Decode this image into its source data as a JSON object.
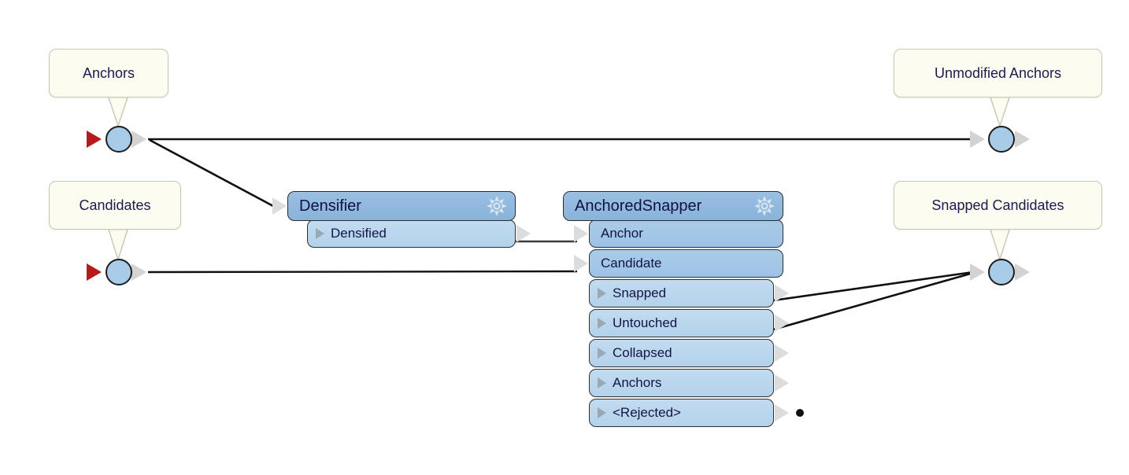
{
  "diagram": {
    "title": "AnchoredSnapper data flow graph",
    "background": "#ffffff",
    "colors": {
      "balloon_fill": "#fdfcf0",
      "balloon_border": "#c9c6b4",
      "header_fill": "#8ab3da",
      "input_row_fill": "#9dc3e4",
      "output_row_fill": "#b3d2ea",
      "port_circle_fill": "#a8cbe8",
      "required_marker": "#b51b1b",
      "connector_arrow": "#dcdcdc",
      "wire": "#111111",
      "text": "#141446"
    }
  },
  "labels": {
    "anchors": "Anchors",
    "candidates": "Candidates",
    "unmodified_anchors": "Unmodified Anchors",
    "snapped_candidates": "Snapped Candidates"
  },
  "modules": [
    {
      "id": "densifier",
      "title": "Densifier",
      "settings_icon": "gear-icon",
      "rows": [
        {
          "label": "Densified",
          "kind": "output",
          "expander": true,
          "arrow": "out"
        }
      ]
    },
    {
      "id": "anchored_snapper",
      "title": "AnchoredSnapper",
      "settings_icon": "gear-icon",
      "rows": [
        {
          "label": "Anchor",
          "kind": "input",
          "expander": false,
          "arrow": "in"
        },
        {
          "label": "Candidate",
          "kind": "input",
          "expander": false,
          "arrow": "in"
        },
        {
          "label": "Snapped",
          "kind": "output",
          "expander": true,
          "arrow": "out"
        },
        {
          "label": "Untouched",
          "kind": "output",
          "expander": true,
          "arrow": "out"
        },
        {
          "label": "Collapsed",
          "kind": "output",
          "expander": true,
          "arrow": "out"
        },
        {
          "label": "Anchors",
          "kind": "output",
          "expander": true,
          "arrow": "out"
        },
        {
          "label": "<Rejected>",
          "kind": "output",
          "expander": true,
          "arrow": "out",
          "terminator_dot": true
        }
      ]
    }
  ],
  "graph_ports": [
    {
      "id": "anchors-port",
      "role": "source",
      "required_marker": true,
      "label_ref": "anchors"
    },
    {
      "id": "candidates-port",
      "role": "source",
      "required_marker": true,
      "label_ref": "candidates"
    },
    {
      "id": "unmodified-anchors-port",
      "role": "sink",
      "required_marker": false,
      "label_ref": "unmodified_anchors"
    },
    {
      "id": "snapped-candidates-port",
      "role": "sink",
      "required_marker": false,
      "label_ref": "snapped_candidates"
    }
  ],
  "connections": [
    {
      "from": "anchors-port",
      "to": "unmodified-anchors-port"
    },
    {
      "from": "anchors-port",
      "to": "densifier.input"
    },
    {
      "from": "densifier.Densified",
      "to": "anchored_snapper.Anchor"
    },
    {
      "from": "candidates-port",
      "to": "anchored_snapper.Candidate"
    },
    {
      "from": "anchored_snapper.Snapped",
      "to": "snapped-candidates-port"
    },
    {
      "from": "anchored_snapper.Untouched",
      "to": "snapped-candidates-port"
    }
  ]
}
